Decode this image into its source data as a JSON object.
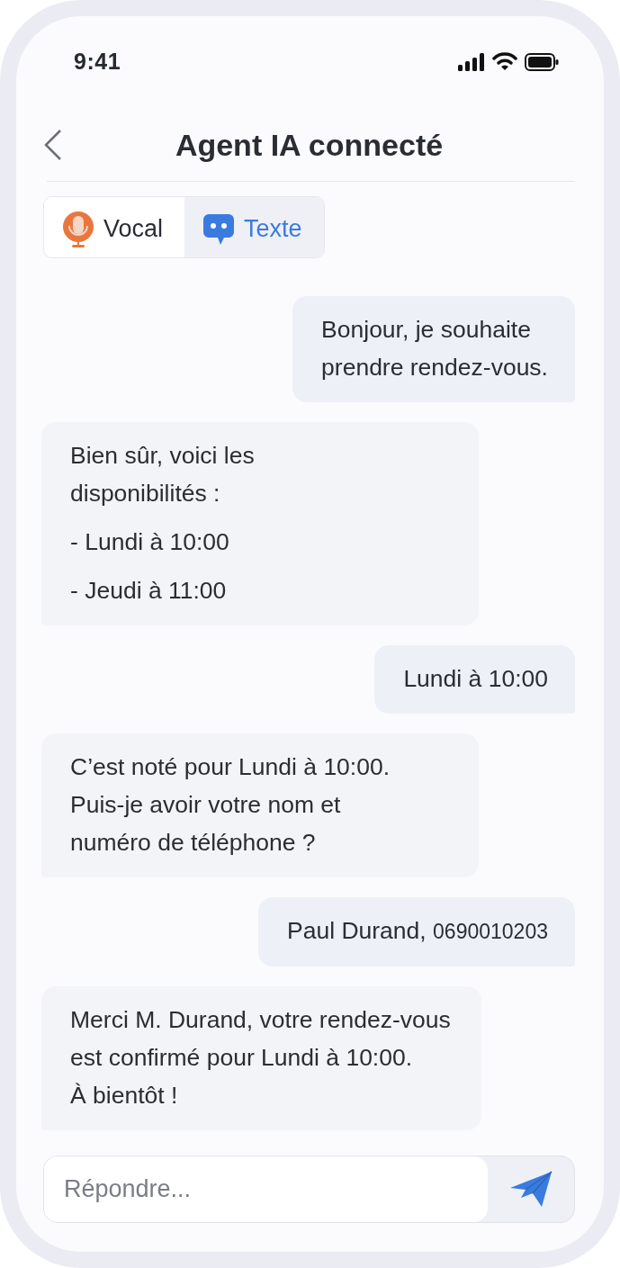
{
  "status_bar": {
    "time": "9:41"
  },
  "header": {
    "title": "Agent IA connecté"
  },
  "tabs": [
    {
      "label": "Vocal",
      "kind": "voice",
      "selected": false
    },
    {
      "label": "Texte",
      "kind": "text",
      "selected": true
    }
  ],
  "messages": [
    {
      "kind": "outgoing",
      "text": "Bonjour, je souhaite\nprendre rendez-vous."
    },
    {
      "kind": "incoming",
      "text": "Bien sûr, voici les\ndisponibilités :",
      "items": [
        "- Lundi à 10:00",
        "- Jeudi à 11:00"
      ]
    },
    {
      "kind": "outgoing",
      "text": "Lundi à 10:00"
    },
    {
      "kind": "incoming",
      "text": "C’est noté pour Lundi à 10:00.\nPuis-je avoir votre nom et\nnuméro de téléphone ?"
    },
    {
      "kind": "outgoing",
      "text": "Paul Durand,",
      "detail": "0690010203"
    },
    {
      "kind": "incoming",
      "text": "Merci M. Durand, votre rendez-vous\nest confirmé pour Lundi à 10:00.\nÀ bientôt !"
    }
  ],
  "composer": {
    "placeholder": "Répondre..."
  }
}
